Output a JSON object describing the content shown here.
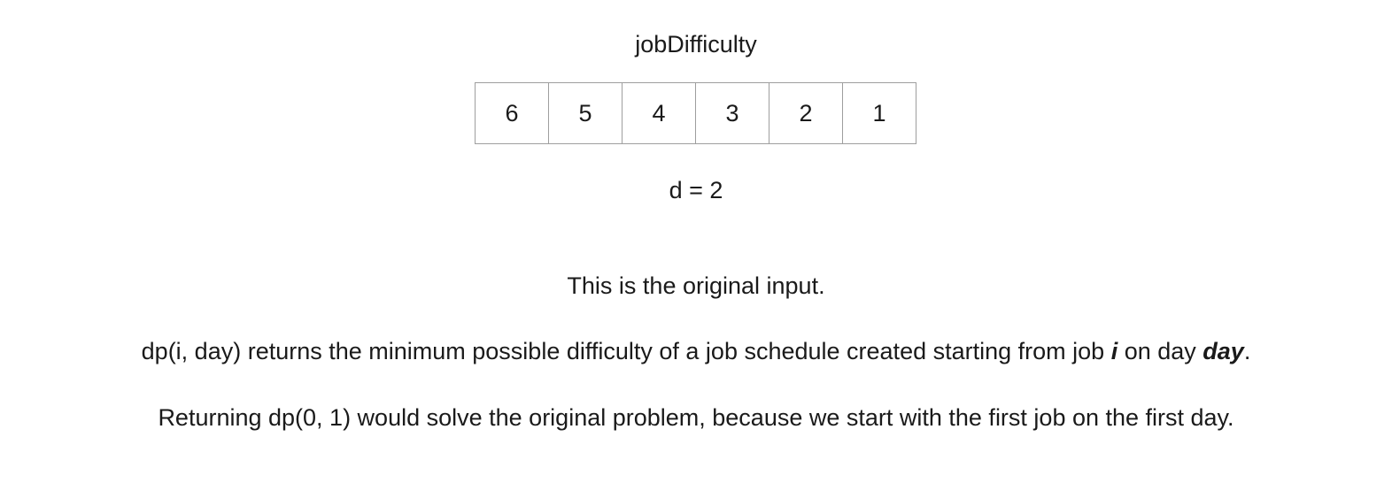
{
  "diagram": {
    "array_label": "jobDifficulty",
    "array_values": [
      "6",
      "5",
      "4",
      "3",
      "2",
      "1"
    ],
    "d_label": "d = 2"
  },
  "text": {
    "line1": "This is the original input.",
    "line2": {
      "part1": "dp(i, day) returns the minimum possible difficulty of a job schedule created starting from job ",
      "var_i": "i",
      "part2": " on day ",
      "var_day": "day",
      "part3": "."
    },
    "line3": "Returning dp(0, 1) would solve the original problem, because we start with the first job on the first day."
  }
}
